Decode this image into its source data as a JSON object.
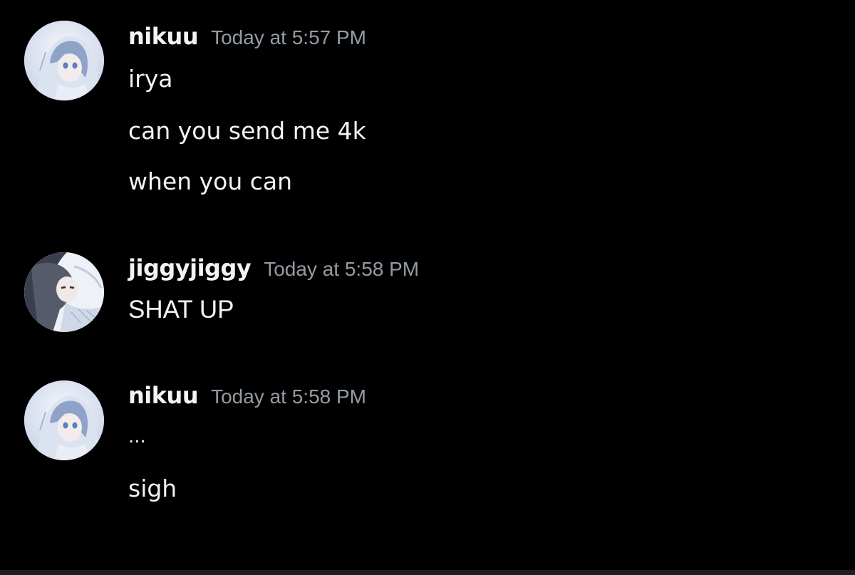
{
  "messages": [
    {
      "username": "nikuu",
      "timestamp": "Today at 5:57 PM",
      "avatar_icon": "anime-girl-avatar-icon",
      "lines": [
        "irya",
        "can you send me 4k",
        "when you can"
      ]
    },
    {
      "username": "jiggyjiggy",
      "timestamp": "Today at 5:58 PM",
      "avatar_icon": "anime-girl-dark-hair-avatar-icon",
      "lines": [
        "SHAT UP"
      ]
    },
    {
      "username": "nikuu",
      "timestamp": "Today at 5:58 PM",
      "avatar_icon": "anime-girl-avatar-icon",
      "lines": [
        "...",
        "sigh"
      ]
    }
  ],
  "colors": {
    "background": "#000000",
    "text": "#f2f3f5",
    "timestamp": "#949ba4"
  }
}
